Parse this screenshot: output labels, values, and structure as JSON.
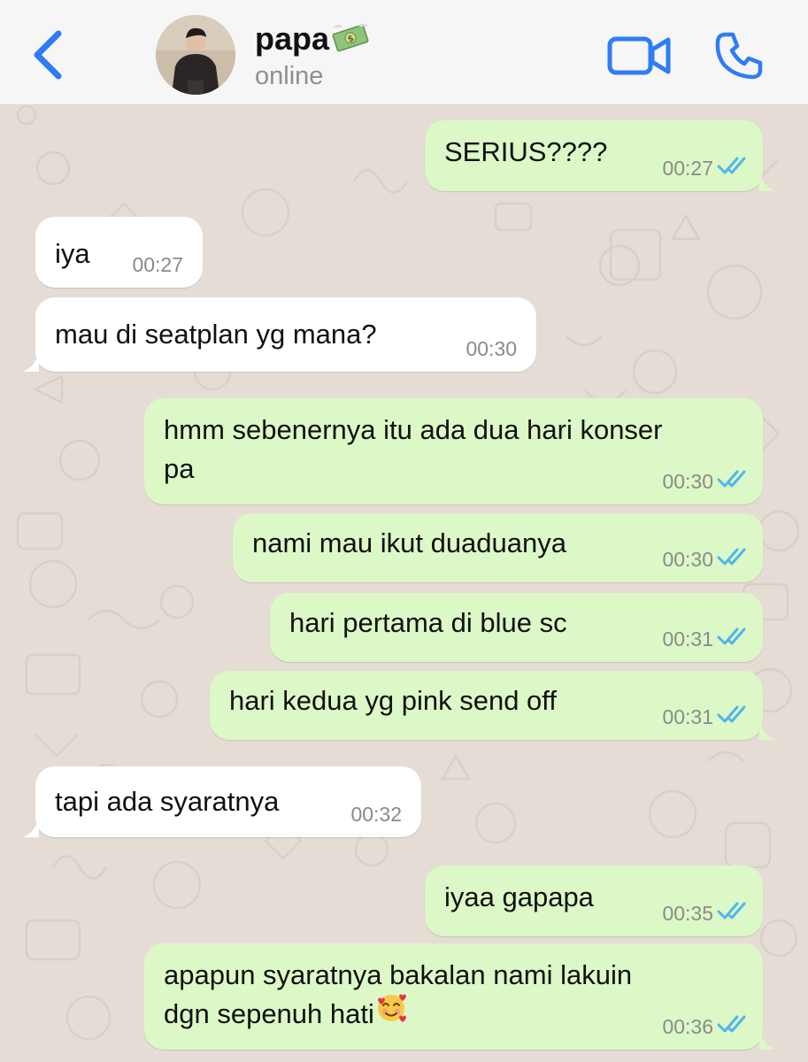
{
  "header": {
    "contact_name": "papa",
    "status": "online",
    "name_emoji": "money-with-wings-emoji"
  },
  "icons": {
    "back": "chevron-left-icon",
    "video": "video-camera-icon",
    "call": "phone-icon",
    "read": "double-check-icon"
  },
  "colors": {
    "accent": "#2f7cf6",
    "outgoing_bubble": "#dcf8c6",
    "incoming_bubble": "#ffffff",
    "read_ticks": "#4fb6ec",
    "wallpaper": "#e5ddd5"
  },
  "messages": [
    {
      "direction": "out",
      "lines": [
        "SERIUS????"
      ],
      "time": "00:27",
      "status": "read"
    },
    {
      "direction": "in",
      "lines": [
        "iya"
      ],
      "time": "00:27"
    },
    {
      "direction": "in",
      "lines": [
        "mau di seatplan yg mana?"
      ],
      "time": "00:30"
    },
    {
      "direction": "out",
      "lines": [
        "hmm sebenernya itu ada dua hari konser",
        "pa"
      ],
      "time": "00:30",
      "status": "read"
    },
    {
      "direction": "out",
      "lines": [
        "nami mau ikut duaduanya"
      ],
      "time": "00:30",
      "status": "read"
    },
    {
      "direction": "out",
      "lines": [
        "hari pertama di blue sc"
      ],
      "time": "00:31",
      "status": "read"
    },
    {
      "direction": "out",
      "lines": [
        "hari kedua yg pink send off"
      ],
      "time": "00:31",
      "status": "read"
    },
    {
      "direction": "in",
      "lines": [
        "tapi ada syaratnya"
      ],
      "time": "00:32"
    },
    {
      "direction": "out",
      "lines": [
        "iyaa gapapa"
      ],
      "time": "00:35",
      "status": "read"
    },
    {
      "direction": "out",
      "lines": [
        "apapun syaratnya bakalan nami lakuin",
        "dgn sepenuh hati"
      ],
      "time": "00:36",
      "status": "read",
      "trailing_emoji": "smiling-face-with-hearts-emoji"
    }
  ]
}
